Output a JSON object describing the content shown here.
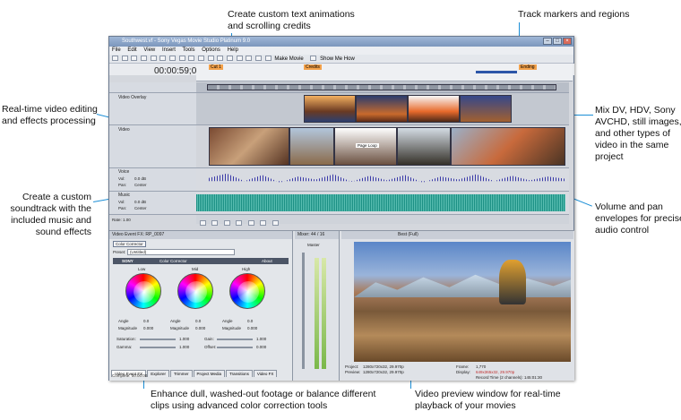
{
  "callouts": {
    "text_animations": "Create custom text animations\nand scrolling credits",
    "track_markers": "Track markers and regions",
    "realtime_editing": "Real-time video editing\nand effects processing",
    "mix_formats": "Mix DV, HDV, Sony\nAVCHD, still images,\nand other types of\nvideo in the same\nproject",
    "soundtrack": "Create a custom\nsoundtrack with the\nincluded music and\nsound effects",
    "volume_pan": "Volume and pan\nenvelopes for precise\naudio control",
    "color_correction": "Enhance dull, washed-out footage or balance different\nclips using advanced color correction tools",
    "video_preview": "Video preview window for real-time\nplayback of your movies"
  },
  "app": {
    "title": "Southwest.vf - Sony Vegas Movie Studio Platinum 9.0",
    "menu": [
      "File",
      "Edit",
      "View",
      "Insert",
      "Tools",
      "Options",
      "Help"
    ],
    "make_movie": "Make Movie",
    "show_me_how": "Show Me How",
    "timecode": "00:00:59;00",
    "markers": [
      "Cut 1",
      "Credits",
      "Ending"
    ],
    "tracks": [
      {
        "name": "",
        "type": "text"
      },
      {
        "name": "Video Overlay",
        "type": "video"
      },
      {
        "name": "Video",
        "type": "video"
      },
      {
        "name": "Voice",
        "vol": "0.0 dB",
        "pan": "Center",
        "type": "audio"
      },
      {
        "name": "Music",
        "vol": "0.0 dB",
        "pan": "Center",
        "type": "audio"
      }
    ],
    "vol_label": "Vol:",
    "pan_label": "Pan:",
    "rate": "Rate: 1.00",
    "title_overlay": "Page Loop",
    "fx_panel": {
      "header": "Video Event FX: RP_0097",
      "effect": "Color Corrector",
      "preset_label": "Preset:",
      "preset_value": "(Untitled)",
      "brand": "SONY",
      "plugin": "Color Corrector",
      "about": "About",
      "wheels": [
        "Low",
        "Mid",
        "High"
      ],
      "angle_label": "Angle",
      "magnitude_label": "Magnitude",
      "angle_val": "0.0",
      "magnitude_val": "0.000",
      "saturation_label": "Saturation:",
      "saturation": "1.000",
      "gain_label": "Gain:",
      "gain": "1.000",
      "gamma_label": "Gamma:",
      "gamma": "1.000",
      "offset_label": "Offset:",
      "offset": "0.000",
      "tabs": [
        "Video Event FX",
        "Explorer",
        "Trimmer",
        "Project Media",
        "Transitions",
        "Video FX"
      ],
      "status": "Complete: 00:00:00"
    },
    "mixer": {
      "header": "Mixer: 44 / 16",
      "master": "Master"
    },
    "preview": {
      "quality": "Best (Full)",
      "project_label": "Project:",
      "project": "1280x720x32, 29.970p",
      "preview_label": "Preview:",
      "preview_res": "1280x720x32, 29.970p",
      "frame_label": "Frame:",
      "frame": "1,770",
      "display_label": "Display:",
      "display": "649x365x32, 29.970p",
      "record_time": "Record Time (2 channels): 145:01:30"
    }
  },
  "colors": {
    "callout_line": "#1b8ed6",
    "audio_wave_voice": "#3a3aa8",
    "audio_wave_music": "#1a8f83"
  }
}
